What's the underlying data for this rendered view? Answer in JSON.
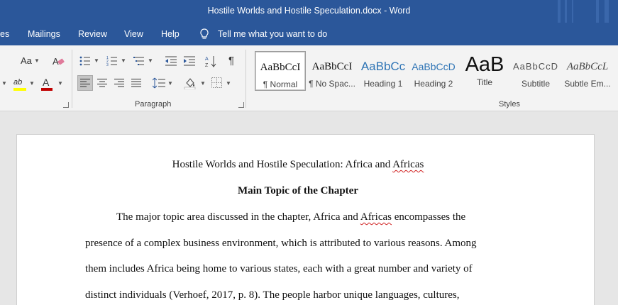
{
  "window": {
    "title": "Hostile Worlds and Hostile Speculation.docx  -  Word"
  },
  "menu": {
    "tabs": [
      "es",
      "Mailings",
      "Review",
      "View",
      "Help"
    ],
    "tell_me": "Tell me what you want to do"
  },
  "ribbon": {
    "groups": {
      "paragraph": "Paragraph",
      "styles": "Styles"
    },
    "styles": [
      {
        "sample": "AaBbCcI",
        "name": "¶ Normal"
      },
      {
        "sample": "AaBbCcI",
        "name": "¶ No Spac..."
      },
      {
        "sample": "AaBbCc",
        "name": "Heading 1"
      },
      {
        "sample": "AaBbCcD",
        "name": "Heading 2"
      },
      {
        "sample": "AaB",
        "name": "Title"
      },
      {
        "sample": "AaBbCcD",
        "name": "Subtitle"
      },
      {
        "sample": "AaBbCcL",
        "name": "Subtle Em..."
      }
    ],
    "font_size_label": "Aa",
    "highlight_label": "ab",
    "font_color_label": "A",
    "colors": {
      "highlight": "#ffff00",
      "font": "#c00000",
      "accent": "#2b579a"
    }
  },
  "document": {
    "title_pre": "Hostile Worlds and Hostile Speculation: Africa and ",
    "title_err": "Africas",
    "heading": "Main Topic of the Chapter",
    "p1_pre": "The major topic area discussed in the chapter, Africa and ",
    "p1_err": "Africas",
    "p1_post": " encompasses the",
    "line2": "presence of a complex business environment, which is attributed to various reasons. Among",
    "line3": "them includes Africa being home to various states, each with a great number and variety of",
    "line4": "distinct individuals (Verhoef, 2017, p. 8). The people harbor unique languages, cultures,"
  }
}
